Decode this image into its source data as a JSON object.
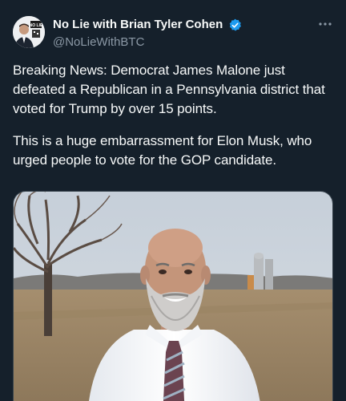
{
  "author": {
    "name": "No Lie with Brian Tyler Cohen",
    "handle": "@NoLieWithBTC",
    "avatar_text": "NO LIE"
  },
  "icons": {
    "verified": "verified-badge-icon",
    "more": "more-options-icon"
  },
  "colors": {
    "background": "#15202b",
    "verified": "#1d9bf0",
    "secondary_text": "#8b98a5"
  },
  "tweet": {
    "paragraph_1": "Breaking News: Democrat James Malone just defeated a Republican in a Pennsylvania district that voted for Trump by over 15 points.",
    "paragraph_2": "This is a huge embarrassment for Elon Musk, who urged people to vote for the GOP candidate."
  },
  "media": {
    "kind": "photo",
    "subject": "man with gray beard in white shirt and striped tie outdoors"
  }
}
